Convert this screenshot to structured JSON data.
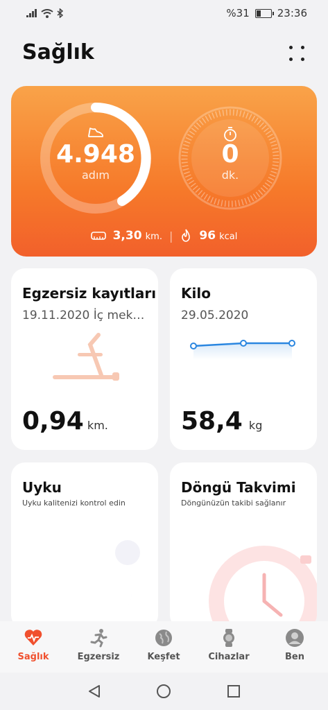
{
  "status": {
    "battery": "%31",
    "time": "23:36"
  },
  "header": {
    "title": "Sağlık"
  },
  "activity": {
    "steps_value": "4.948",
    "steps_unit": "adım",
    "minutes_value": "0",
    "minutes_unit": "dk.",
    "distance_value": "3,30",
    "distance_unit": "km.",
    "calories_value": "96",
    "calories_unit": "kcal"
  },
  "cards": {
    "exercise": {
      "title": "Egzersiz kayıtları",
      "subtitle": "19.11.2020 İç mek…",
      "value": "0,94",
      "unit": "km."
    },
    "weight": {
      "title": "Kilo",
      "subtitle": "29.05.2020",
      "value": "58,4",
      "unit": "kg"
    },
    "sleep": {
      "title": "Uyku",
      "subtitle": "Uyku kalitenizi kontrol edin"
    },
    "cycle": {
      "title": "Döngü Takvimi",
      "subtitle": "Döngünüzün takibi sağlanır"
    }
  },
  "nav": [
    {
      "label": "Sağlık",
      "icon": "heart-pulse-icon",
      "active": true
    },
    {
      "label": "Egzersiz",
      "icon": "running-icon",
      "active": false
    },
    {
      "label": "Keşfet",
      "icon": "globe-icon",
      "active": false
    },
    {
      "label": "Cihazlar",
      "icon": "watch-icon",
      "active": false
    },
    {
      "label": "Ben",
      "icon": "person-icon",
      "active": false
    }
  ],
  "colors": {
    "accent": "#f0502e",
    "hero_top": "#f9a349",
    "hero_bottom": "#f2602b",
    "weight_line": "#2a86e0"
  }
}
